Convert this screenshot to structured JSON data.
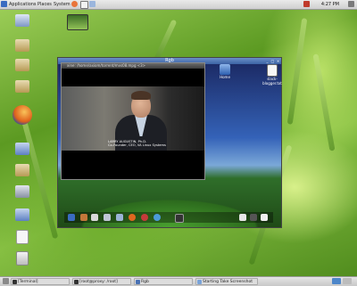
{
  "top_panel": {
    "menus": [
      "Applications",
      "Places",
      "System"
    ],
    "clock": "4:27 PM"
  },
  "rgb_window": {
    "title": "Rgb"
  },
  "video_window": {
    "title": "xine: /home/axiom/torrent/mvs08.mpg <3>",
    "lower_third_name": "LARRY AUGUSTIN, Ph.D.",
    "lower_third_role": "Co-Founder, CEO, VA Linux Systems"
  },
  "inner_desktop_icons": [
    {
      "label": "Home"
    },
    {
      "label": "slack-blogger.txt"
    }
  ],
  "taskbar": {
    "items": [
      {
        "label": "[Terminal]"
      },
      {
        "label": "[root@proxy: /root]"
      },
      {
        "label": "Rgb"
      },
      {
        "label": "Starting Take Screenshot"
      }
    ]
  },
  "colors": {
    "panel": "#d8d8d8",
    "title_active": "#4a72b4",
    "wallpaper_green": "#7bb83a"
  }
}
